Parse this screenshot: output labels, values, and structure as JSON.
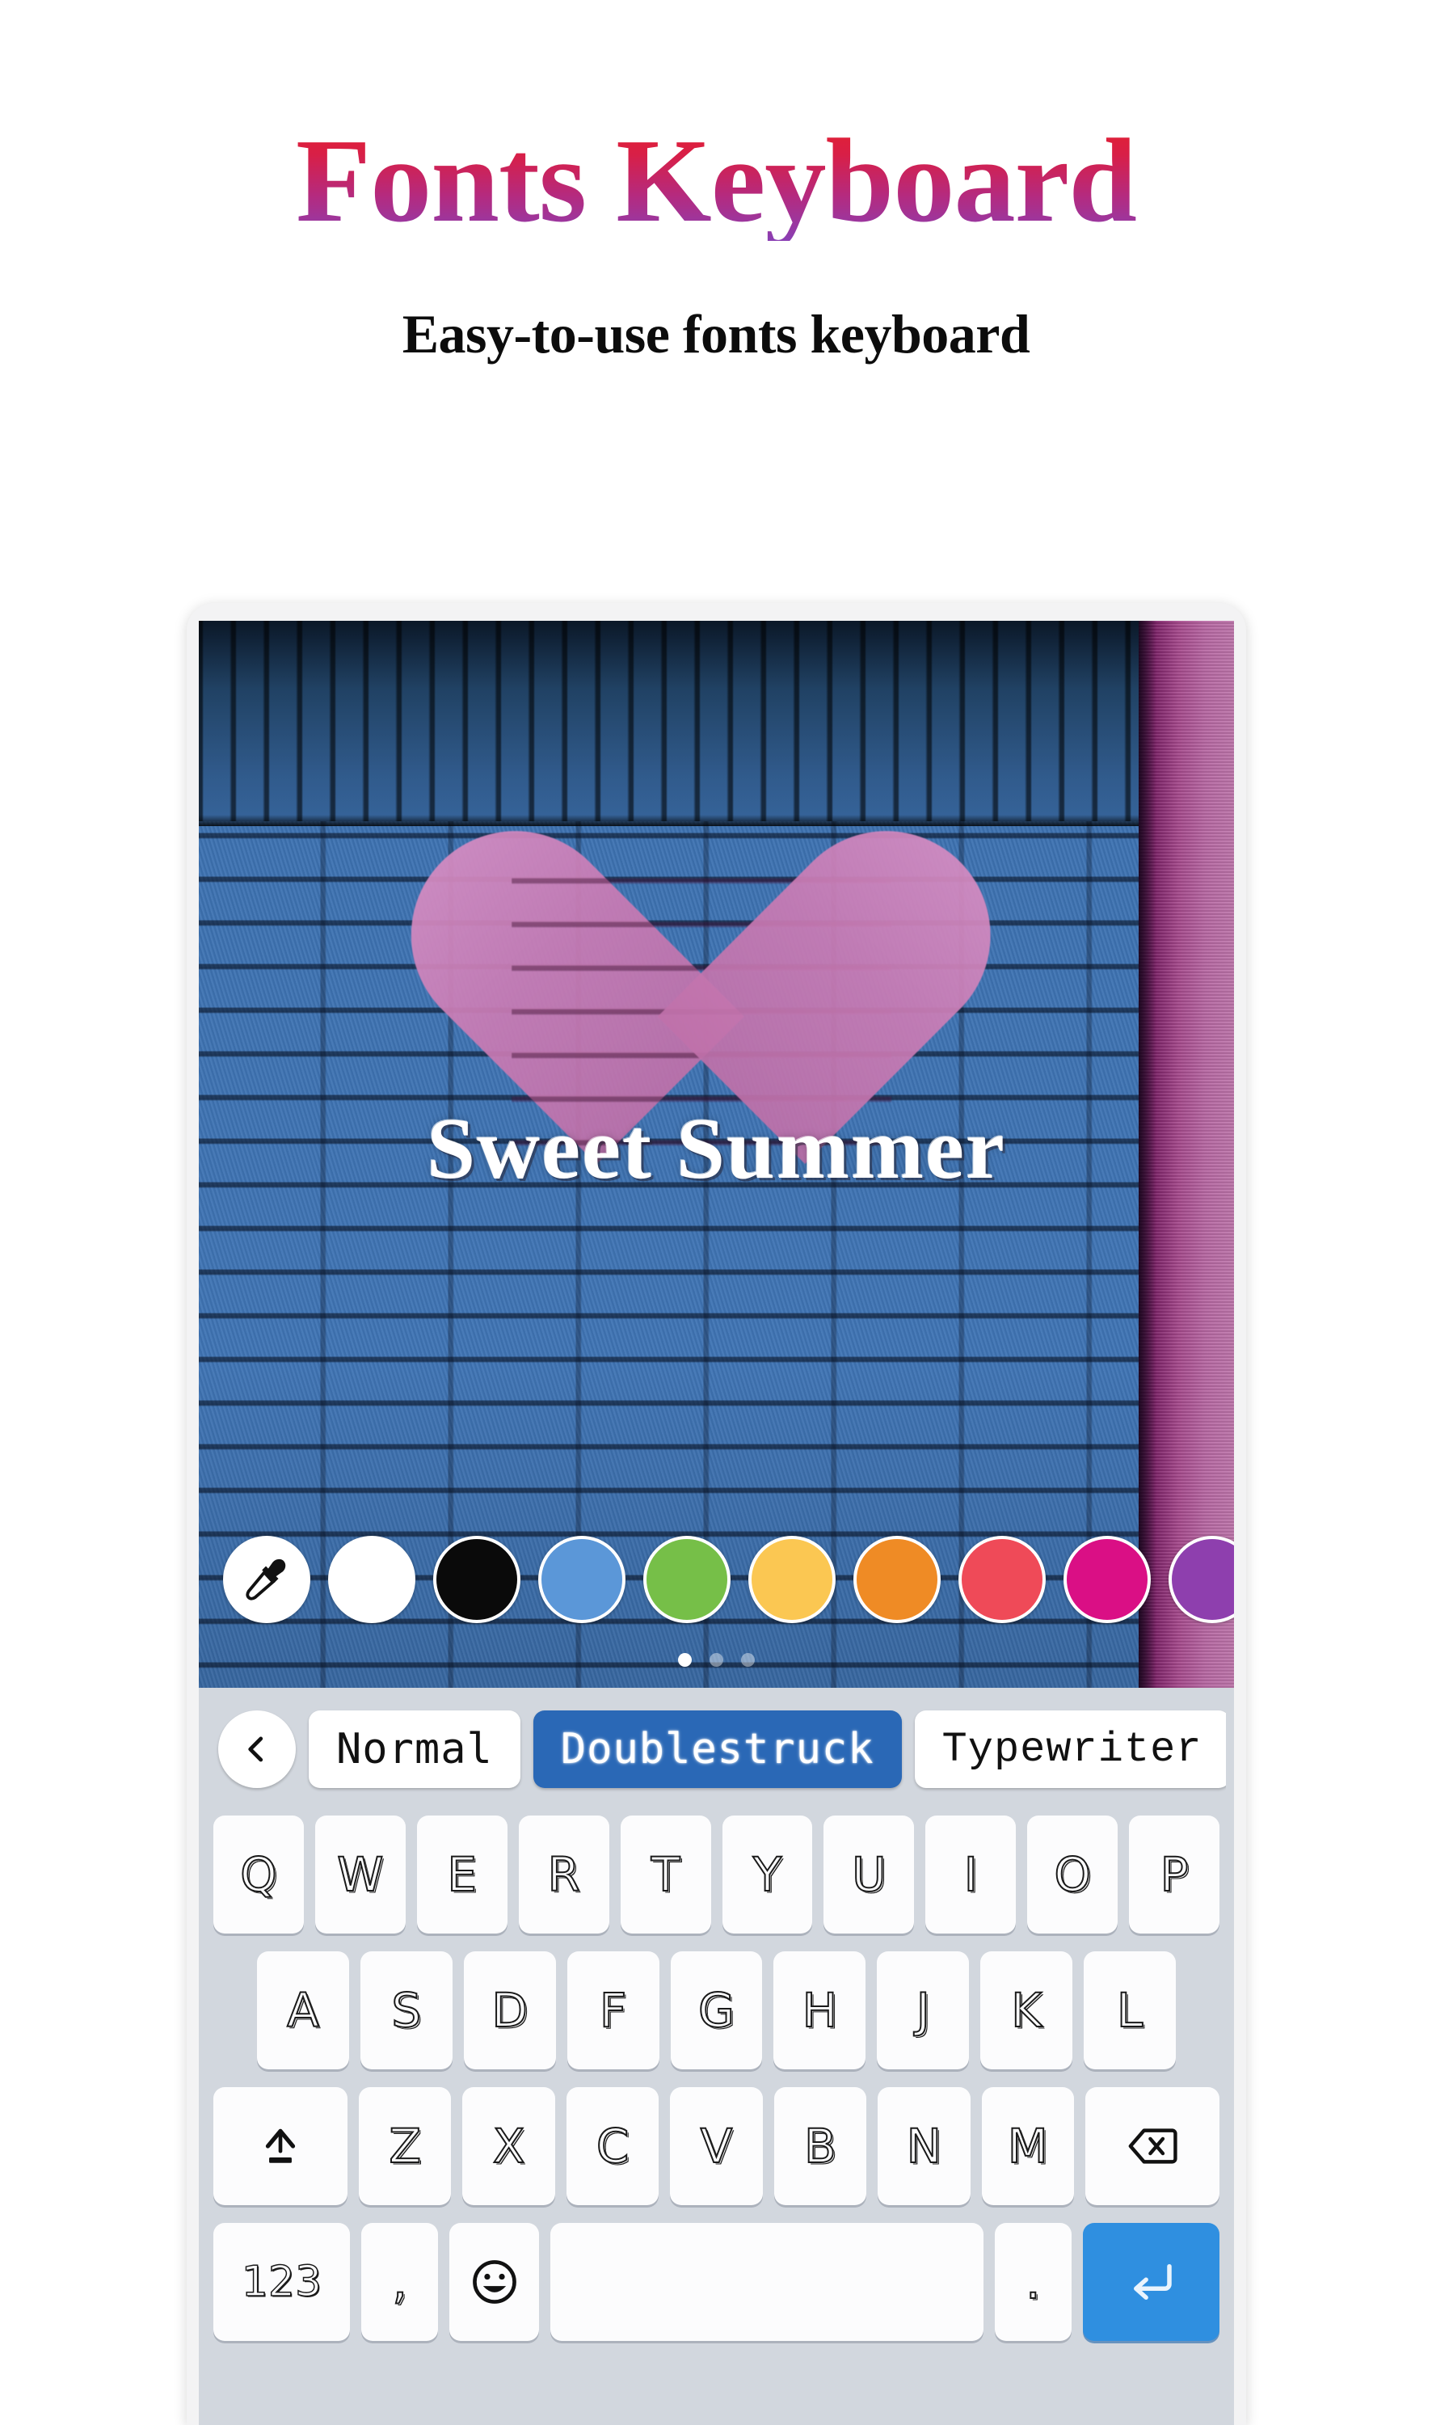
{
  "header": {
    "title": "Fonts Keyboard",
    "subtitle": "Easy-to-use fonts keyboard",
    "title_gradient_from": "#e4202e",
    "title_gradient_to": "#8a3fb4",
    "subtitle_color": "#0c0c0c"
  },
  "canvas": {
    "overlay_text": "Sweet Summer",
    "overlay_text_color": "#ffffff",
    "wall_color": "#3d72b1",
    "heart_color": "#cb7cb5",
    "right_strip_color": "#bb6aa6",
    "swatches": [
      {
        "name": "eyedropper",
        "icon": "eyedropper-icon",
        "color": "#ffffff"
      },
      {
        "name": "white",
        "icon": "",
        "color": "#ffffff"
      },
      {
        "name": "black",
        "icon": "",
        "color": "#0a0a0a"
      },
      {
        "name": "blue",
        "icon": "",
        "color": "#5b97d8"
      },
      {
        "name": "green",
        "icon": "",
        "color": "#76bf48"
      },
      {
        "name": "yellow",
        "icon": "",
        "color": "#fbc752"
      },
      {
        "name": "orange",
        "icon": "",
        "color": "#ef8b25"
      },
      {
        "name": "red",
        "icon": "",
        "color": "#ef4a58"
      },
      {
        "name": "magenta",
        "icon": "",
        "color": "#da0f85"
      },
      {
        "name": "purple",
        "icon": "",
        "color": "#8e3fae"
      }
    ],
    "page_dots": {
      "count": 3,
      "active_index": 0
    }
  },
  "keyboard": {
    "background": "#d2d7de",
    "back_button_icon": "chevron-left-icon",
    "font_chips": [
      {
        "label": "Normal",
        "style": "normal",
        "selected": false
      },
      {
        "label": "Doublestruck",
        "style": "selected",
        "selected": true
      },
      {
        "label": "Typewriter",
        "style": "mono",
        "selected": false
      }
    ],
    "selected_chip_color": "#2a68b6",
    "row1": [
      "Q",
      "W",
      "E",
      "R",
      "T",
      "Y",
      "U",
      "I",
      "O",
      "P"
    ],
    "row2": [
      "A",
      "S",
      "D",
      "F",
      "G",
      "H",
      "J",
      "K",
      "L"
    ],
    "row3_letters": [
      "Z",
      "X",
      "C",
      "V",
      "B",
      "N",
      "M"
    ],
    "shift_icon": "shift-up-icon",
    "backspace_icon": "backspace-icon",
    "row4": {
      "numeric_label": "123",
      "comma_label": ",",
      "emoji_icon": "emoji-smiley-icon",
      "space_label": "",
      "period_label": ".",
      "enter_icon": "enter-return-icon",
      "enter_color": "#2f8fe0"
    }
  }
}
